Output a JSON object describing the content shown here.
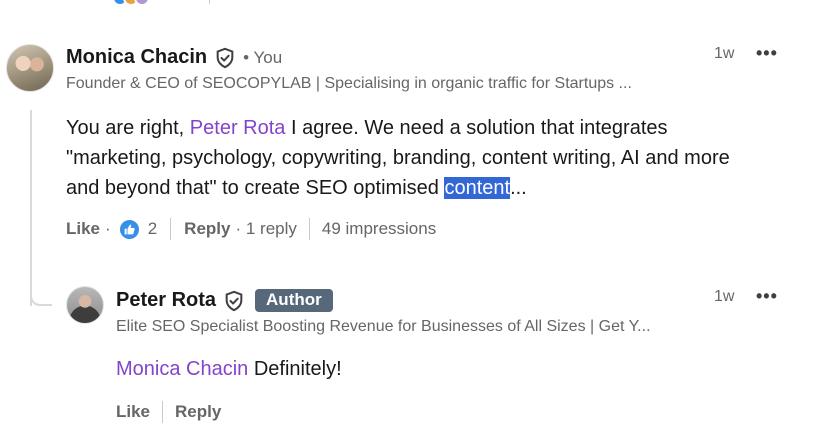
{
  "comment": {
    "author_name": "Monica Chacin",
    "you_label": "• You",
    "headline": "Founder & CEO of SEOCOPYLAB | Specialising in organic traffic for Startups ...",
    "timestamp": "1w",
    "text_prefix": "You are right,",
    "mention": "Peter Rota",
    "text_line1_rest": "I agree. We need a solution that integrates",
    "text_line2": "\"marketing, psychology, copywriting, branding, content writing, AI and more",
    "text_line3_before": "and beyond that\" to create SEO optimised",
    "highlighted_word": "content",
    "text_ellipsis": "...",
    "like_label": "Like",
    "like_dot": "·",
    "reaction_count": "2",
    "reply_label": "Reply",
    "reply_count": "· 1 reply",
    "impressions": "49 impressions"
  },
  "reply": {
    "author_name": "Peter Rota",
    "author_badge": "Author",
    "headline": "Elite SEO Specialist Boosting Revenue for Businesses of All Sizes | Get Y...",
    "timestamp": "1w",
    "mention": "Monica Chacin",
    "text": "Definitely!",
    "like_label": "Like",
    "reply_label": "Reply"
  },
  "colors": {
    "mention": "#8344cc",
    "highlight": "#3367d6",
    "badge": "#56687a",
    "like_blue": "#378fe9"
  }
}
